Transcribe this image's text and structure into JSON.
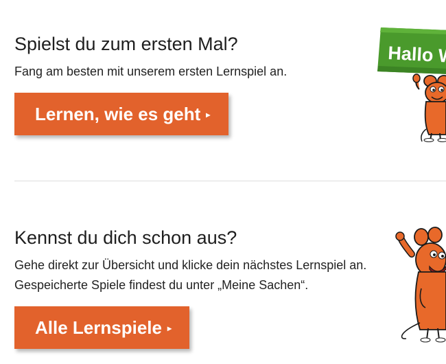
{
  "intro": {
    "heading": "Spielst du zum ersten Mal?",
    "text": "Fang am besten mit unserem ersten Lernspiel an.",
    "button_label": "Lernen, wie es geht",
    "button_arrow": "▸"
  },
  "returning": {
    "heading": "Kennst du dich schon aus?",
    "text_line_1": "Gehe direkt zur Übersicht und klicke dein nächstes Lernspiel an.",
    "text_line_2": "Gespeicherte Spiele findest du unter „Meine Sachen“.",
    "button_label": "Alle Lernspiele",
    "button_arrow": "▸"
  },
  "sign": {
    "text": "Hallo W"
  },
  "colors": {
    "accent": "#e2622c",
    "sign_green": "#4a9a2c",
    "mouse_orange": "#e8692a"
  }
}
